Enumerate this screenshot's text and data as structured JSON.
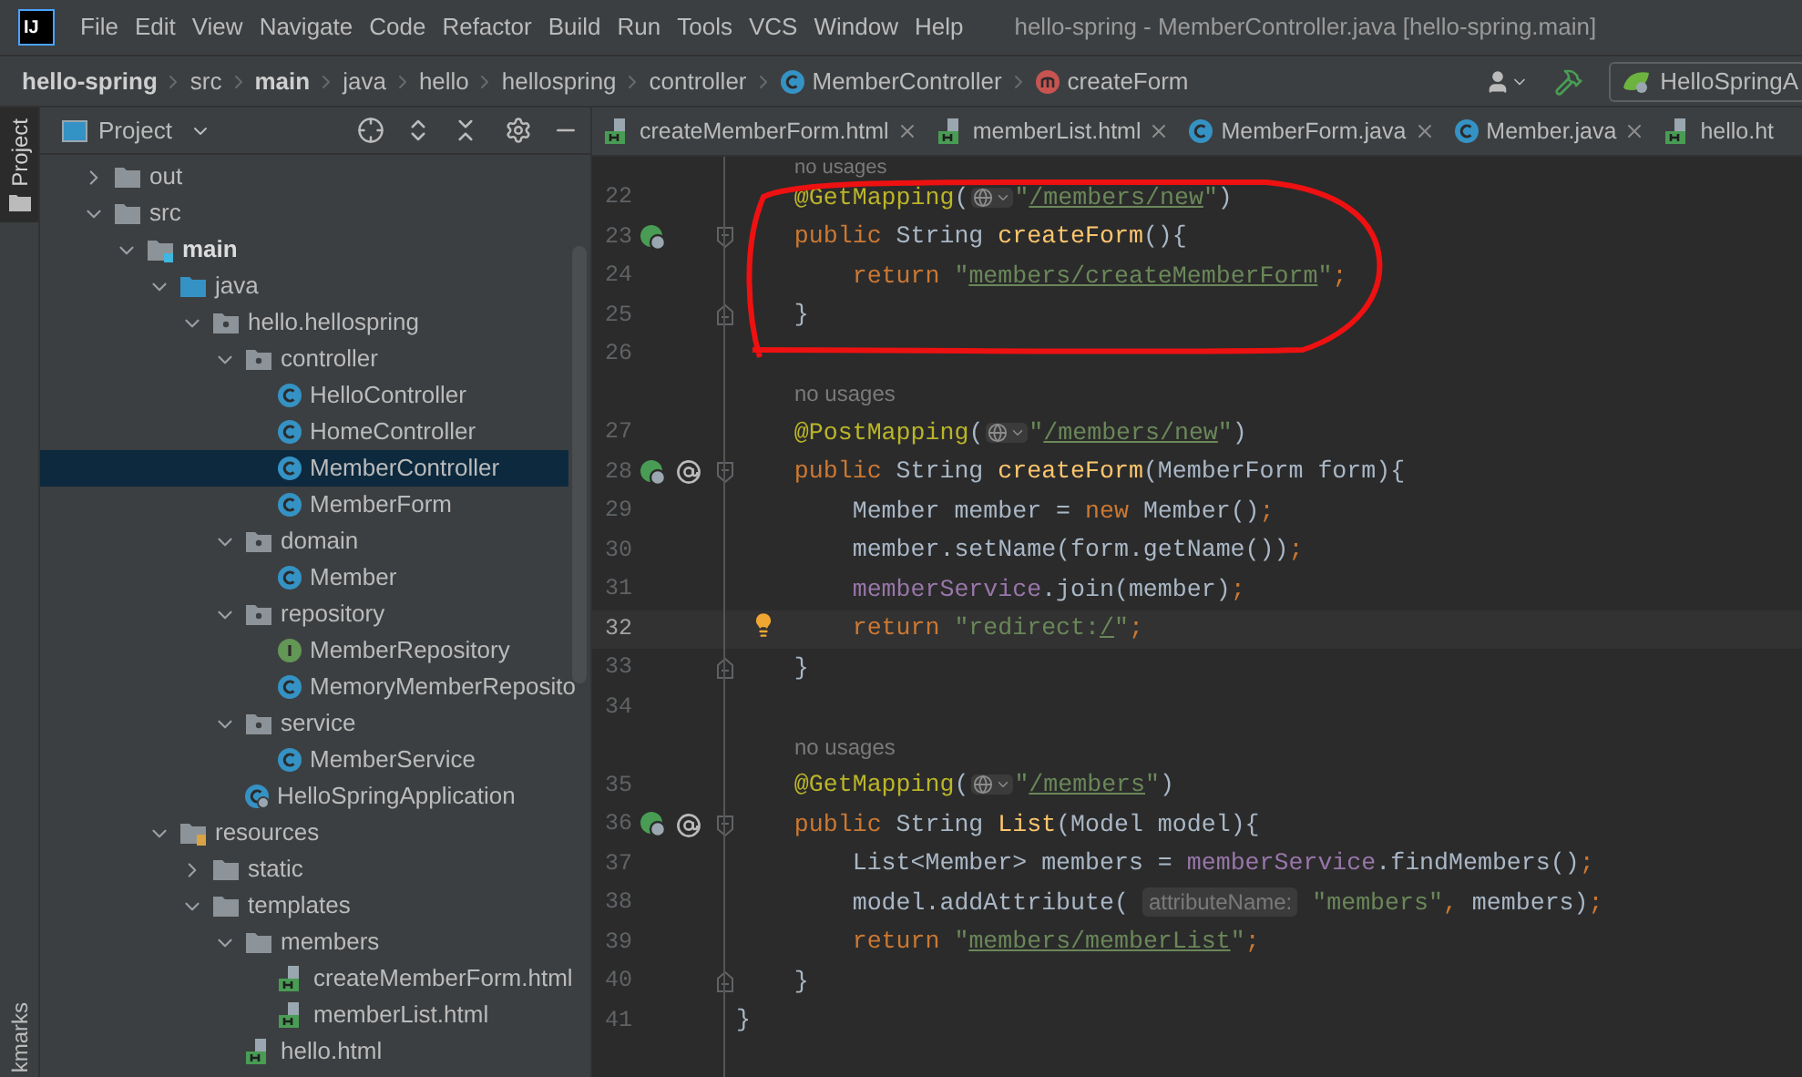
{
  "app_logo": "IJ",
  "menu": [
    "File",
    "Edit",
    "View",
    "Navigate",
    "Code",
    "Refactor",
    "Build",
    "Run",
    "Tools",
    "VCS",
    "Window",
    "Help"
  ],
  "window": {
    "title": "hello-spring - MemberController.java [hello-spring.main]"
  },
  "breadcrumbs": [
    {
      "label": "hello-spring",
      "kind": "project"
    },
    {
      "label": "src",
      "kind": "dir"
    },
    {
      "label": "main",
      "kind": "project"
    },
    {
      "label": "java",
      "kind": "dir"
    },
    {
      "label": "hello",
      "kind": "dir"
    },
    {
      "label": "hellospring",
      "kind": "dir"
    },
    {
      "label": "controller",
      "kind": "dir"
    },
    {
      "label": "MemberController",
      "kind": "class"
    },
    {
      "label": "createForm",
      "kind": "method"
    }
  ],
  "run_config": "HelloSpringA",
  "tool_stripe": {
    "top": {
      "label": "Project",
      "selected": true
    },
    "bottom": {
      "label": "kmarks",
      "selected": false
    }
  },
  "project_panel": {
    "title": "Project",
    "tree": [
      {
        "label": "out",
        "kind": "folder",
        "expanded": false,
        "selected": false
      },
      {
        "label": "src",
        "kind": "folder",
        "expanded": true,
        "selected": false,
        "children": [
          {
            "label": "main",
            "kind": "module",
            "expanded": true,
            "selected": false,
            "children": [
              {
                "label": "java",
                "kind": "source",
                "expanded": true,
                "selected": false,
                "children": [
                  {
                    "label": "hello.hellospring",
                    "kind": "package",
                    "expanded": true,
                    "selected": false,
                    "children": [
                      {
                        "label": "controller",
                        "kind": "package",
                        "expanded": true,
                        "selected": false,
                        "children": [
                          {
                            "label": "HelloController",
                            "kind": "class",
                            "selected": false
                          },
                          {
                            "label": "HomeController",
                            "kind": "class",
                            "selected": false
                          },
                          {
                            "label": "MemberController",
                            "kind": "class",
                            "selected": true
                          },
                          {
                            "label": "MemberForm",
                            "kind": "class",
                            "selected": false
                          }
                        ]
                      },
                      {
                        "label": "domain",
                        "kind": "package",
                        "expanded": true,
                        "selected": false,
                        "children": [
                          {
                            "label": "Member",
                            "kind": "class",
                            "selected": false
                          }
                        ]
                      },
                      {
                        "label": "repository",
                        "kind": "package",
                        "expanded": true,
                        "selected": false,
                        "children": [
                          {
                            "label": "MemberRepository",
                            "kind": "interface",
                            "selected": false
                          },
                          {
                            "label": "MemoryMemberReposito",
                            "kind": "class",
                            "selected": false
                          }
                        ]
                      },
                      {
                        "label": "service",
                        "kind": "package",
                        "expanded": true,
                        "selected": false,
                        "children": [
                          {
                            "label": "MemberService",
                            "kind": "class",
                            "selected": false
                          }
                        ]
                      },
                      {
                        "label": "HelloSpringApplication",
                        "kind": "app",
                        "selected": false
                      }
                    ]
                  }
                ]
              },
              {
                "label": "resources",
                "kind": "resources",
                "expanded": true,
                "selected": false,
                "children": [
                  {
                    "label": "static",
                    "kind": "folder",
                    "expanded": false,
                    "selected": false
                  },
                  {
                    "label": "templates",
                    "kind": "folder",
                    "expanded": true,
                    "selected": false,
                    "children": [
                      {
                        "label": "members",
                        "kind": "folder",
                        "expanded": true,
                        "selected": false,
                        "children": [
                          {
                            "label": "createMemberForm.html",
                            "kind": "html",
                            "selected": false
                          },
                          {
                            "label": "memberList.html",
                            "kind": "html",
                            "selected": false
                          }
                        ]
                      },
                      {
                        "label": "hello.html",
                        "kind": "html",
                        "selected": false
                      }
                    ]
                  }
                ]
              }
            ]
          }
        ]
      }
    ]
  },
  "editor_tabs": [
    {
      "label": "createMemberForm.html",
      "kind": "html",
      "selected": false,
      "closable": true
    },
    {
      "label": "memberList.html",
      "kind": "html",
      "selected": false,
      "closable": true
    },
    {
      "label": "MemberForm.java",
      "kind": "class",
      "selected": false,
      "closable": true
    },
    {
      "label": "Member.java",
      "kind": "class",
      "selected": false,
      "closable": true
    },
    {
      "label": "hello.ht",
      "kind": "html",
      "selected": false,
      "closable": false
    }
  ],
  "editor_lines": [
    {
      "kind": "hint",
      "text": "no usages"
    },
    {
      "kind": "code",
      "number": "22",
      "current": false,
      "tokens": [
        {
          "kind": "annotation",
          "text": "    @GetMapping"
        },
        {
          "kind": "plain",
          "text": "("
        },
        {
          "kind": "globe"
        },
        {
          "kind": "string",
          "text": "\""
        },
        {
          "kind": "url",
          "text": "/members/new"
        },
        {
          "kind": "string",
          "text": "\""
        },
        {
          "kind": "plain",
          "text": ")"
        }
      ]
    },
    {
      "kind": "code",
      "number": "23",
      "current": false,
      "fold_start": true,
      "markers": [
        {
          "kind": "bean"
        }
      ],
      "tokens": [
        {
          "kind": "keyword",
          "text": "    public "
        },
        {
          "kind": "plain",
          "text": "String "
        },
        {
          "kind": "method",
          "text": "createForm"
        },
        {
          "kind": "plain",
          "text": "(){"
        }
      ]
    },
    {
      "kind": "code",
      "number": "24",
      "current": false,
      "tokens": [
        {
          "kind": "keyword",
          "text": "        return "
        },
        {
          "kind": "string",
          "text": "\""
        },
        {
          "kind": "url",
          "text": "members/createMemberForm"
        },
        {
          "kind": "string",
          "text": "\""
        },
        {
          "kind": "keyword",
          "text": ";"
        }
      ]
    },
    {
      "kind": "code",
      "number": "25",
      "current": false,
      "fold_end": true,
      "tokens": [
        {
          "kind": "plain",
          "text": "    }"
        }
      ]
    },
    {
      "kind": "code",
      "number": "26",
      "current": false
    },
    {
      "kind": "hint",
      "text": "no usages"
    },
    {
      "kind": "code",
      "number": "27",
      "current": false,
      "tokens": [
        {
          "kind": "annotation",
          "text": "    @PostMapping"
        },
        {
          "kind": "plain",
          "text": "("
        },
        {
          "kind": "globe"
        },
        {
          "kind": "string",
          "text": "\""
        },
        {
          "kind": "url",
          "text": "/members/new"
        },
        {
          "kind": "string",
          "text": "\""
        },
        {
          "kind": "plain",
          "text": ")"
        }
      ]
    },
    {
      "kind": "code",
      "number": "28",
      "current": false,
      "fold_start": true,
      "markers": [
        {
          "kind": "bean"
        },
        {
          "kind": "at"
        }
      ],
      "tokens": [
        {
          "kind": "keyword",
          "text": "    public "
        },
        {
          "kind": "plain",
          "text": "String "
        },
        {
          "kind": "method",
          "text": "createForm"
        },
        {
          "kind": "plain",
          "text": "(MemberForm form){"
        }
      ]
    },
    {
      "kind": "code",
      "number": "29",
      "current": false,
      "tokens": [
        {
          "kind": "plain",
          "text": "        Member member = "
        },
        {
          "kind": "keyword",
          "text": "new "
        },
        {
          "kind": "plain",
          "text": "Member()"
        },
        {
          "kind": "keyword",
          "text": ";"
        }
      ]
    },
    {
      "kind": "code",
      "number": "30",
      "current": false,
      "tokens": [
        {
          "kind": "plain",
          "text": "        member.setName(form.getName())"
        },
        {
          "kind": "keyword",
          "text": ";"
        }
      ]
    },
    {
      "kind": "code",
      "number": "31",
      "current": false,
      "tokens": [
        {
          "kind": "field",
          "text": "        memberService"
        },
        {
          "kind": "plain",
          "text": ".join(member)"
        },
        {
          "kind": "keyword",
          "text": ";"
        }
      ]
    },
    {
      "kind": "code",
      "number": "32",
      "current": true,
      "bulb": true,
      "tokens": [
        {
          "kind": "keyword",
          "text": "        return "
        },
        {
          "kind": "string",
          "text": "\"redirect:"
        },
        {
          "kind": "url",
          "text": "/"
        },
        {
          "kind": "string",
          "text": "\""
        },
        {
          "kind": "keyword",
          "text": ";"
        }
      ]
    },
    {
      "kind": "code",
      "number": "33",
      "current": false,
      "fold_end": true,
      "tokens": [
        {
          "kind": "plain",
          "text": "    }"
        }
      ]
    },
    {
      "kind": "code",
      "number": "34",
      "current": false
    },
    {
      "kind": "hint",
      "text": "no usages"
    },
    {
      "kind": "code",
      "number": "35",
      "current": false,
      "tokens": [
        {
          "kind": "annotation",
          "text": "    @GetMapping"
        },
        {
          "kind": "plain",
          "text": "("
        },
        {
          "kind": "globe"
        },
        {
          "kind": "string",
          "text": "\""
        },
        {
          "kind": "url",
          "text": "/members"
        },
        {
          "kind": "string",
          "text": "\""
        },
        {
          "kind": "plain",
          "text": ")"
        }
      ]
    },
    {
      "kind": "code",
      "number": "36",
      "current": false,
      "fold_start": true,
      "markers": [
        {
          "kind": "bean"
        },
        {
          "kind": "at"
        }
      ],
      "tokens": [
        {
          "kind": "keyword",
          "text": "    public "
        },
        {
          "kind": "plain",
          "text": "String "
        },
        {
          "kind": "method",
          "text": "List"
        },
        {
          "kind": "plain",
          "text": "(Model model){"
        }
      ]
    },
    {
      "kind": "code",
      "number": "37",
      "current": false,
      "tokens": [
        {
          "kind": "plain",
          "text": "        List<Member> members = "
        },
        {
          "kind": "field",
          "text": "memberService"
        },
        {
          "kind": "plain",
          "text": ".findMembers()"
        },
        {
          "kind": "keyword",
          "text": ";"
        }
      ]
    },
    {
      "kind": "code",
      "number": "38",
      "current": false,
      "tokens": [
        {
          "kind": "plain",
          "text": "        model.addAttribute( "
        },
        {
          "kind": "inlay",
          "text": "attributeName:"
        },
        {
          "kind": "string",
          "text": " \"members\""
        },
        {
          "kind": "keyword",
          "text": ", "
        },
        {
          "kind": "plain",
          "text": "members)"
        },
        {
          "kind": "keyword",
          "text": ";"
        }
      ]
    },
    {
      "kind": "code",
      "number": "39",
      "current": false,
      "tokens": [
        {
          "kind": "keyword",
          "text": "        return "
        },
        {
          "kind": "string",
          "text": "\""
        },
        {
          "kind": "url",
          "text": "members/memberList"
        },
        {
          "kind": "string",
          "text": "\""
        },
        {
          "kind": "keyword",
          "text": ";"
        }
      ]
    },
    {
      "kind": "code",
      "number": "40",
      "current": false,
      "fold_end": true,
      "tokens": [
        {
          "kind": "plain",
          "text": "    }"
        }
      ]
    },
    {
      "kind": "code",
      "number": "41",
      "current": false,
      "tokens": [
        {
          "kind": "plain",
          "text": "}"
        }
      ]
    }
  ]
}
